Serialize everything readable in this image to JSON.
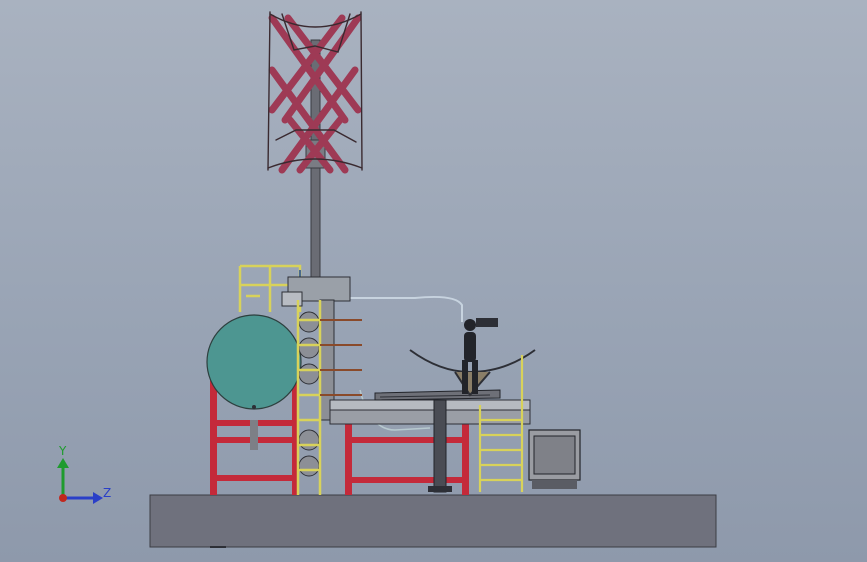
{
  "viewport": {
    "background_top": "#a9b2c0",
    "background_bottom": "#8e99ab"
  },
  "colors": {
    "base_slab": "#6f717d",
    "frame_red": "#c42a3a",
    "rail_yellow": "#d8d25a",
    "tank_teal": "#4d9691",
    "turbine_blade": "#9e3a55",
    "mast_grey": "#6a6c74",
    "steel_grey": "#8b8d93",
    "dark_outline": "#2d2f36",
    "pipe_light": "#c7d3df",
    "axis_x": "#2a3fc8",
    "axis_y": "#1f9b2e",
    "axis_origin": "#c0281e"
  },
  "model": {
    "components": [
      "wind-turbine-rotor",
      "turbine-mast",
      "storage-tank",
      "support-frame",
      "access-ladder",
      "rotor-columns",
      "platform-deck",
      "parabolic-blades",
      "stair-tower",
      "control-cabinet",
      "base-slab",
      "pipe-line"
    ]
  },
  "triad": {
    "y_label": "Y",
    "z_label": "Z",
    "icons": [
      "axis-y-arrow-icon",
      "axis-z-arrow-icon",
      "origin-dot-icon"
    ]
  }
}
